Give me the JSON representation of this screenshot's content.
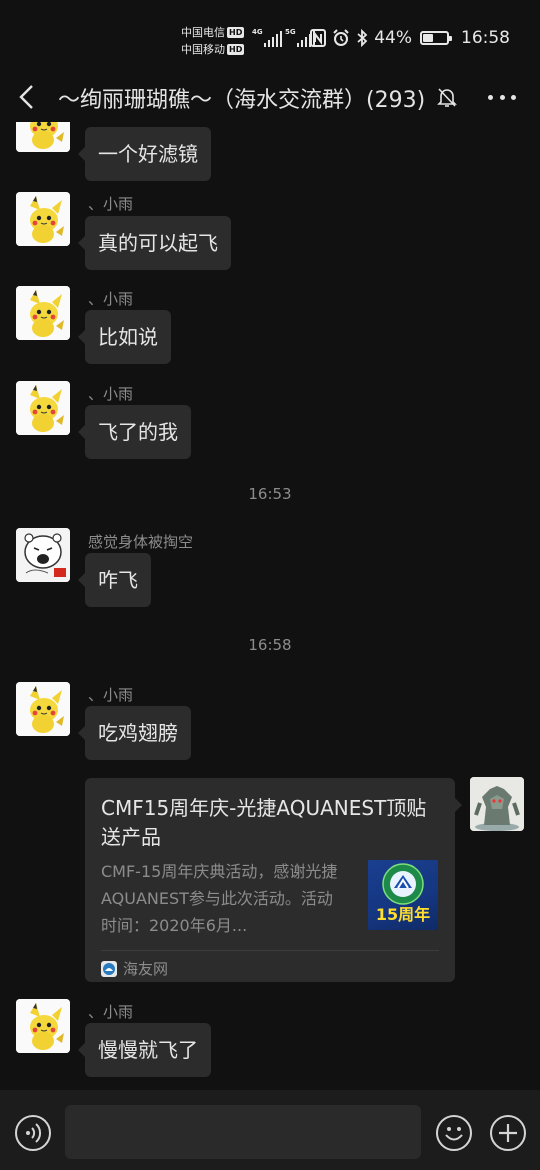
{
  "status_bar": {
    "carrier_1": "中国电信",
    "carrier_2": "中国移动",
    "hd_badge": "HD",
    "network_1": "4G",
    "network_2": "5G",
    "battery_percent": "44%",
    "battery_level": 0.44,
    "time": "16:58"
  },
  "header": {
    "title": "～绚丽珊瑚礁～（海水交流群）(293)",
    "icons": [
      "back-icon",
      "mute-bell-icon",
      "more-icon"
    ]
  },
  "messages": [
    {
      "sender": "",
      "text": "一个好滤镜",
      "avatar": "pikachu-avatar"
    },
    {
      "sender": "、小雨",
      "text": "真的可以起飞",
      "avatar": "pikachu-avatar"
    },
    {
      "sender": "、小雨",
      "text": "比如说",
      "avatar": "pikachu-avatar"
    },
    {
      "sender": "、小雨",
      "text": "飞了的我",
      "avatar": "pikachu-avatar"
    },
    {
      "timestamp": "16:53"
    },
    {
      "sender": "感觉身体被掏空",
      "text": "咋飞",
      "avatar": "meme-face-avatar"
    },
    {
      "timestamp": "16:58"
    },
    {
      "sender": "、小雨",
      "text": "吃鸡翅膀",
      "avatar": "pikachu-avatar"
    },
    {
      "type": "link_card",
      "title": "CMF15周年庆-光捷AQUANEST顶贴送产品",
      "description": "CMF-15周年庆典活动，感谢光捷AQUANEST参与此次活动。活动时间：2020年6月...",
      "thumbnail_label": "15周年",
      "source": "海友网",
      "avatar": "robot-figure-avatar"
    },
    {
      "sender": "、小雨",
      "text": "慢慢就飞了",
      "avatar": "pikachu-avatar"
    }
  ],
  "input_bar": {
    "icons": [
      "voice-icon",
      "emoji-icon",
      "plus-icon"
    ],
    "value": ""
  },
  "colors": {
    "background": "#111111",
    "bubble": "#2c2c2c",
    "text": "#e6e6e6",
    "muted": "#8c8c8c"
  }
}
